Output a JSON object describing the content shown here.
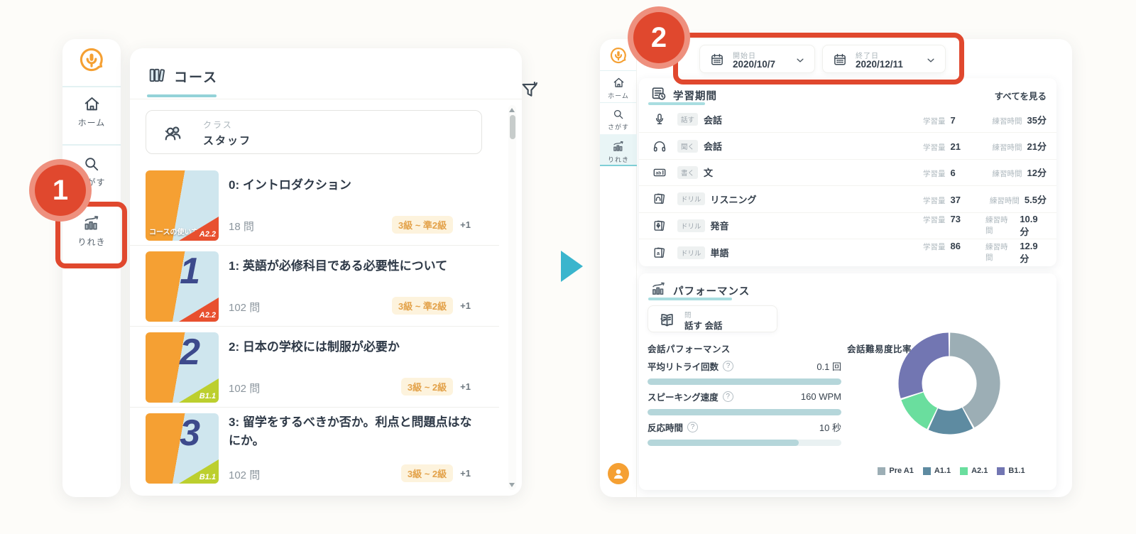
{
  "annotations": {
    "step1": "1",
    "step2": "2"
  },
  "icons": {
    "help_glyph": "?"
  },
  "left_window": {
    "sidebar": {
      "items": [
        {
          "label": "ホーム"
        },
        {
          "label": "さがす"
        },
        {
          "label": "りれき"
        }
      ]
    },
    "header": {
      "title": "コース"
    },
    "class_filter": {
      "label": "クラス",
      "value": "スタッフ"
    },
    "courses": [
      {
        "title": "0: イントロダクション",
        "questions": "18 問",
        "level_range": "3級 ~ 準2級",
        "extra": "+1",
        "thumb": {
          "num": "",
          "caption": "コースの使い方",
          "level": "A2.2",
          "color": "#e8502f"
        }
      },
      {
        "title": "1: 英語が必修科目である必要性について",
        "questions": "102 問",
        "level_range": "3級 ~ 準2級",
        "extra": "+1",
        "thumb": {
          "num": "1",
          "caption": "",
          "level": "A2.2",
          "color": "#e8502f"
        }
      },
      {
        "title": "2: 日本の学校には制服が必要か",
        "questions": "102 問",
        "level_range": "3級 ~ 2級",
        "extra": "+1",
        "thumb": {
          "num": "2",
          "caption": "",
          "level": "B1.1",
          "color": "#bccf2e"
        }
      },
      {
        "title": "3: 留学をするべきか否か。利点と問題点はなにか。",
        "questions": "102 問",
        "level_range": "3級 ~ 2級",
        "extra": "+1",
        "thumb": {
          "num": "3",
          "caption": "",
          "level": "B1.1",
          "color": "#bccf2e"
        }
      }
    ]
  },
  "right_window": {
    "sidebar": {
      "items": [
        {
          "label": "ホーム"
        },
        {
          "label": "さがす"
        },
        {
          "label": "りれき"
        }
      ]
    },
    "date_filters": [
      {
        "label": "開始日",
        "value": "2020/10/7"
      },
      {
        "label": "終了日",
        "value": "2020/12/11"
      }
    ],
    "study_period": {
      "title": "学習期間",
      "see_all": "すべてを見る",
      "amount_label": "学習量",
      "time_label": "練習時間",
      "rows": [
        {
          "tag": "話す",
          "name": "会話",
          "amount": "7",
          "time": "35分"
        },
        {
          "tag": "聞く",
          "name": "会話",
          "amount": "21",
          "time": "21分"
        },
        {
          "tag": "書く",
          "name": "文",
          "amount": "6",
          "time": "12分"
        },
        {
          "tag": "ドリル",
          "name": "リスニング",
          "amount": "37",
          "time": "5.5分"
        },
        {
          "tag": "ドリル",
          "name": "発音",
          "amount": "73",
          "time": "10.9分"
        },
        {
          "tag": "ドリル",
          "name": "単語",
          "amount": "86",
          "time": "12.9分"
        }
      ]
    },
    "performance": {
      "title": "パフォーマンス",
      "lesson_select": {
        "label": "問",
        "value": "話す 会話"
      },
      "left_col_title": "会話パフォーマンス",
      "metrics": [
        {
          "label": "平均リトライ回数",
          "value": "0.1 回",
          "pct": 100
        },
        {
          "label": "スピーキング速度",
          "value": "160 WPM",
          "pct": 100
        },
        {
          "label": "反応時間",
          "value": "10 秒",
          "pct": 78
        }
      ],
      "chart_data": {
        "type": "donut",
        "title": "会話難易度比率",
        "legend_position": "bottom",
        "segments": [
          {
            "label": "Pre A1",
            "value": 42,
            "color": "#9caeb5"
          },
          {
            "label": "A1.1",
            "value": 15,
            "color": "#5e8ba1"
          },
          {
            "label": "A2.1",
            "value": 13,
            "color": "#6ade9e"
          },
          {
            "label": "B1.1",
            "value": 30,
            "color": "#7276b2"
          }
        ]
      }
    }
  }
}
